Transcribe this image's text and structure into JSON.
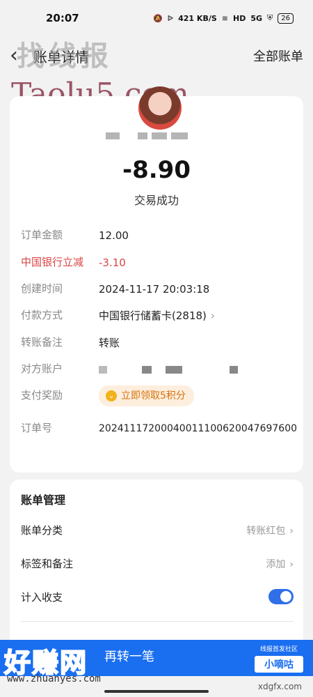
{
  "status_bar": {
    "time": "20:07",
    "speed": "421 KB/S",
    "hd": "HD",
    "signal": "5G",
    "battery": "26"
  },
  "nav": {
    "title": "账单详情",
    "right_action": "全部账单"
  },
  "watermark": {
    "chinese": "找线报",
    "english": "Taolu5.com"
  },
  "transaction": {
    "amount": "-8.90",
    "status": "交易成功"
  },
  "details": [
    {
      "label": "订单金额",
      "value": "12.00"
    },
    {
      "label": "中国银行立减",
      "value": "-3.10"
    },
    {
      "label": "创建时间",
      "value": "2024-11-17 20:03:18"
    },
    {
      "label": "付款方式",
      "value": "中国银行储蓄卡(2818)"
    },
    {
      "label": "转账备注",
      "value": "转账"
    },
    {
      "label": "对方账户",
      "value": ""
    },
    {
      "label": "支付奖励",
      "value": "立即领取5积分"
    },
    {
      "label": "订单号",
      "value": "20241117200040011100620047697600"
    }
  ],
  "management": {
    "title": "账单管理",
    "rows": [
      {
        "label": "账单分类",
        "value": "转账红包"
      },
      {
        "label": "标签和备注",
        "value": "添加"
      },
      {
        "label": "计入收支",
        "value": ""
      }
    ],
    "include_in_stats": true
  },
  "bottom": {
    "button": "再转一笔",
    "badge_top": "线报首发社区",
    "badge_main": "小嘀咕"
  },
  "bottom_watermark": {
    "logo": "好赚网",
    "url": "www.zhuanyes.com",
    "right": "xdgfx.com"
  },
  "colors": {
    "accent": "#2f6fe8",
    "discount": "#d94545",
    "reward": "#d5730a"
  }
}
